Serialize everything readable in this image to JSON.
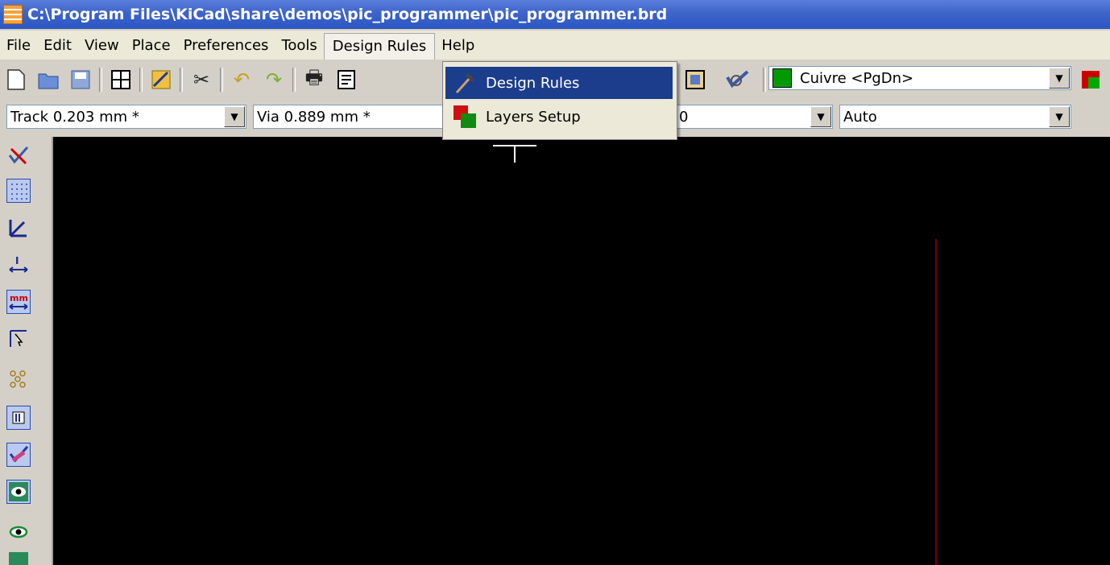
{
  "window": {
    "title": "C:\\Program Files\\KiCad\\share\\demos\\pic_programmer\\pic_programmer.brd"
  },
  "menubar": {
    "items": [
      "File",
      "Edit",
      "View",
      "Place",
      "Preferences",
      "Tools",
      "Design Rules",
      "Help"
    ],
    "open_item": "Design Rules"
  },
  "dropdown": {
    "items": [
      {
        "label": "Design Rules",
        "icon": "hammer-icon",
        "highlighted": true
      },
      {
        "label": "Layers Setup",
        "icon": "layers-icon",
        "highlighted": false
      }
    ]
  },
  "toolbar": {
    "layer_select": {
      "value": "Cuivre <PgDn>",
      "swatch_color": "#009a00"
    }
  },
  "toolbar2": {
    "track_width": "Track 0.203 mm *",
    "via_size": "Via 0.889 mm *",
    "grid_value": "0",
    "zoom_value": "Auto"
  },
  "left_toolbar": {
    "icons": [
      "drc-off-icon",
      "grid-icon",
      "polar-coords-icon",
      "units-inch-icon",
      "units-mm-icon",
      "cursor-shape-icon",
      "ratsnest-icon",
      "module-ratsnest-icon",
      "auto-delete-track-icon",
      "show-zones-icon",
      "show-pads-icon",
      "show-tracks-icon"
    ]
  },
  "colors": {
    "canvas": "#000000",
    "titlebar": "#2b56c4",
    "highlight": "#1c3d8c",
    "board_edge": "#7a0000"
  }
}
